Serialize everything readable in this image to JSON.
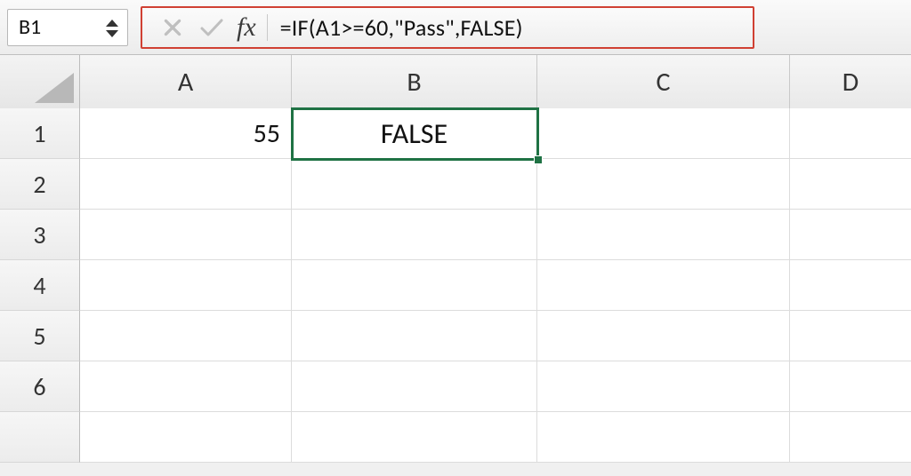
{
  "nameBox": {
    "value": "B1"
  },
  "formulaBar": {
    "fxLabel": "fx",
    "formula": "=IF(A1>=60,\"Pass\",FALSE)"
  },
  "columns": [
    "A",
    "B",
    "C",
    "D"
  ],
  "rows": [
    "1",
    "2",
    "3",
    "4",
    "5",
    "6"
  ],
  "cells": {
    "A1": "55",
    "B1": "FALSE"
  },
  "selection": {
    "ref": "B1"
  },
  "colors": {
    "selectionBorder": "#1f7244",
    "highlightBox": "#d04033"
  }
}
